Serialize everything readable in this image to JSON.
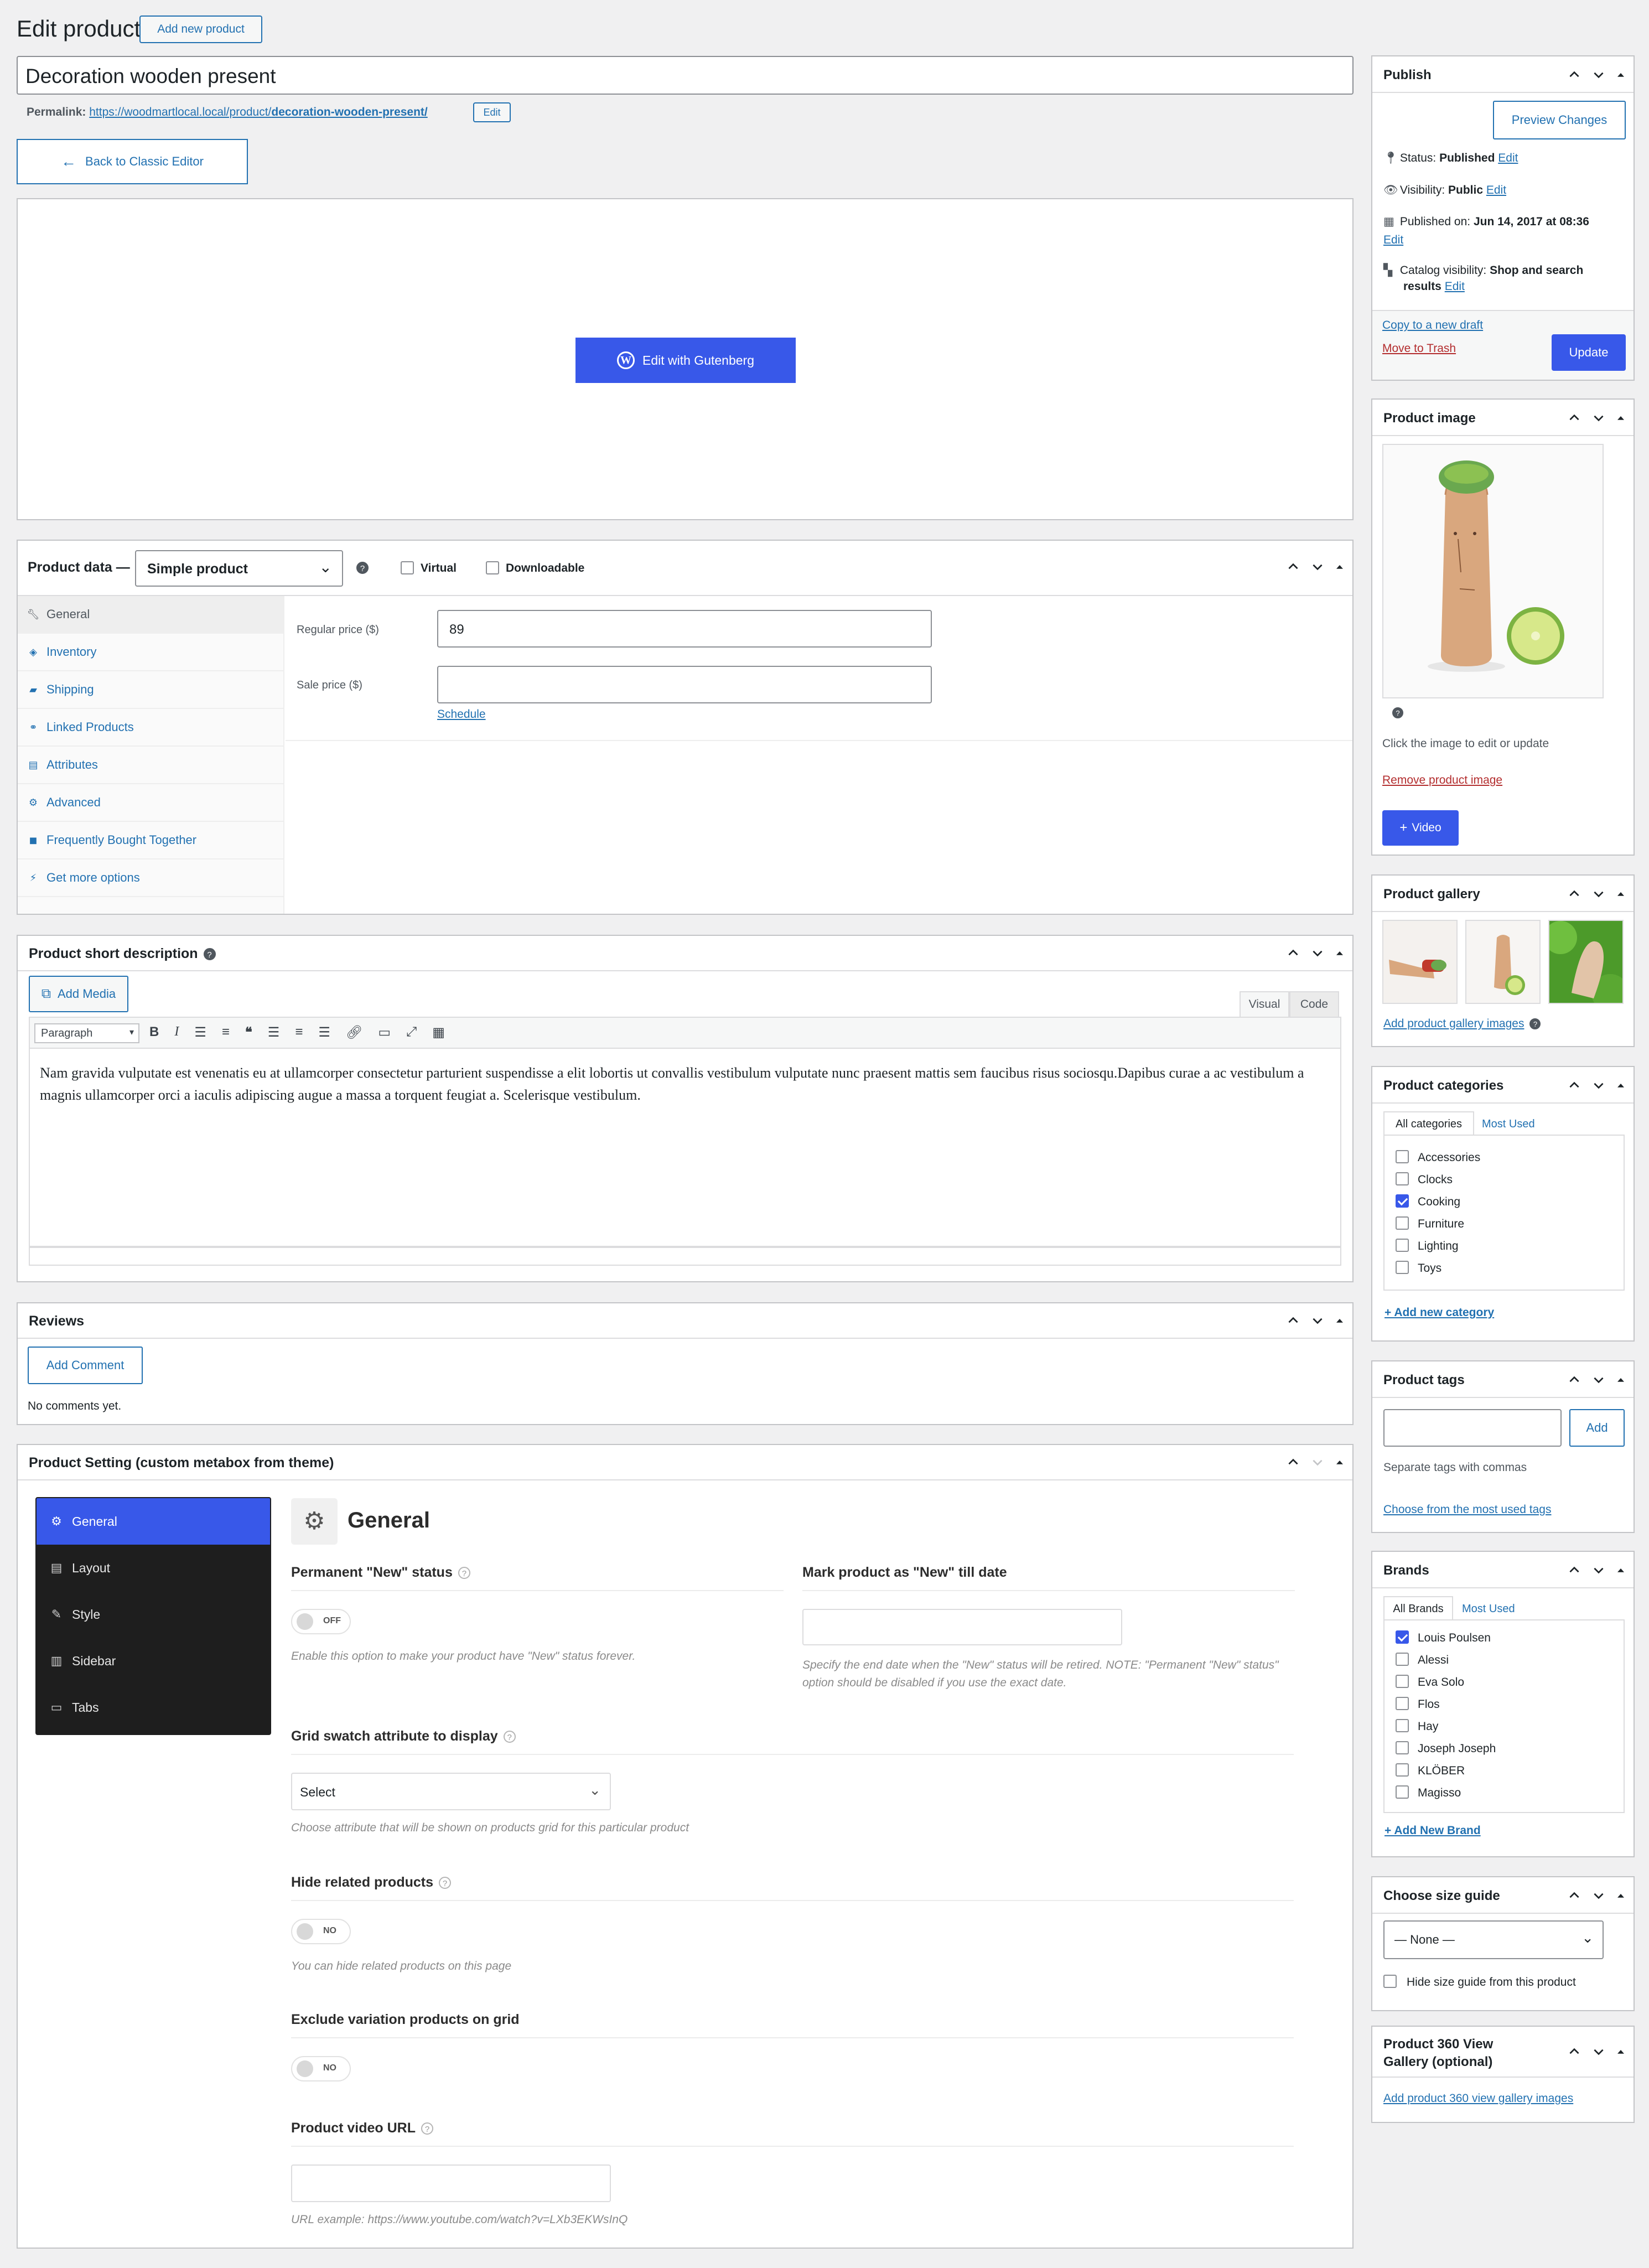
{
  "page": {
    "title": "Edit product",
    "add_new_label": "Add new product",
    "product_title": "Decoration wooden present",
    "permalink_label": "Permalink:",
    "permalink_base": "https://woodmartlocal.local/product/",
    "permalink_slug": "decoration-wooden-present/",
    "permalink_edit": "Edit",
    "back_classic": "Back to Classic Editor",
    "edit_gutenberg": "Edit with Gutenberg"
  },
  "product_data": {
    "title": "Product data —",
    "type": "Simple product",
    "virtual_label": "Virtual",
    "downloadable_label": "Downloadable",
    "tabs": [
      {
        "label": "General",
        "icon": "wrench-icon"
      },
      {
        "label": "Inventory",
        "icon": "tag-icon"
      },
      {
        "label": "Shipping",
        "icon": "truck-icon"
      },
      {
        "label": "Linked Products",
        "icon": "link-icon"
      },
      {
        "label": "Attributes",
        "icon": "table-icon"
      },
      {
        "label": "Advanced",
        "icon": "gear-icon"
      },
      {
        "label": "Frequently Bought Together",
        "icon": "bag-icon"
      },
      {
        "label": "Get more options",
        "icon": "plugin-icon"
      }
    ],
    "regular_price_label": "Regular price ($)",
    "regular_price": "89",
    "sale_price_label": "Sale price ($)",
    "sale_price": "",
    "schedule": "Schedule"
  },
  "short_desc": {
    "title": "Product short description",
    "add_media": "Add Media",
    "tab_visual": "Visual",
    "tab_code": "Code",
    "format": "Paragraph",
    "content": "Nam gravida vulputate est venenatis eu at ullamcorper consectetur parturient suspendisse a elit lobortis ut convallis vestibulum vulputate nunc praesent mattis sem faucibus risus sociosqu.Dapibus curae a ac vestibulum a magnis ullamcorper orci a iaculis adipiscing augue a massa a torquent feugiat a. Scelerisque vestibulum."
  },
  "reviews": {
    "title": "Reviews",
    "add_comment": "Add Comment",
    "empty": "No comments yet."
  },
  "product_setting": {
    "title": "Product Setting (custom metabox from theme)",
    "nav": [
      "General",
      "Layout",
      "Style",
      "Sidebar",
      "Tabs"
    ],
    "section_title": "General",
    "new_status_label": "Permanent \"New\" status",
    "new_status_toggle": "OFF",
    "new_status_desc": "Enable this option to make your product have \"New\" status forever.",
    "new_till_label": "Mark product as \"New\" till date",
    "new_till_value": "",
    "new_till_desc": "Specify the end date when the \"New\" status will be retired. NOTE: \"Permanent \"New\" status\" option should be disabled if you use the exact date.",
    "swatch_label": "Grid swatch attribute to display",
    "swatch_value": "Select",
    "swatch_desc": "Choose attribute that will be shown on products grid for this particular product",
    "hide_related_label": "Hide related products",
    "hide_related_toggle": "NO",
    "hide_related_desc": "You can hide related products on this page",
    "exclude_var_label": "Exclude variation products on grid",
    "exclude_var_toggle": "NO",
    "video_label": "Product video URL",
    "video_value": "",
    "video_desc": "URL example: https://www.youtube.com/watch?v=LXb3EKWsInQ"
  },
  "publish": {
    "title": "Publish",
    "preview": "Preview Changes",
    "status_label": "Status:",
    "status_value": "Published",
    "visibility_label": "Visibility:",
    "visibility_value": "Public",
    "published_label": "Published on:",
    "published_value": "Jun 14, 2017 at 08:36",
    "catalog_label": "Catalog visibility:",
    "catalog_value_1": "Shop and search",
    "catalog_value_2": "results",
    "edit": "Edit",
    "copy_draft": "Copy to a new draft",
    "trash": "Move to Trash",
    "update": "Update"
  },
  "product_image": {
    "title": "Product image",
    "hint": "Click the image to edit or update",
    "remove": "Remove product image",
    "video_btn": "Video"
  },
  "gallery": {
    "title": "Product gallery",
    "add": "Add product gallery images"
  },
  "categories": {
    "title": "Product categories",
    "tab_all": "All categories",
    "tab_used": "Most Used",
    "items": [
      {
        "label": "Accessories",
        "checked": false
      },
      {
        "label": "Clocks",
        "checked": false
      },
      {
        "label": "Cooking",
        "checked": true
      },
      {
        "label": "Furniture",
        "checked": false
      },
      {
        "label": "Lighting",
        "checked": false
      },
      {
        "label": "Toys",
        "checked": false
      }
    ],
    "add_new": "+ Add new category"
  },
  "tags": {
    "title": "Product tags",
    "input_value": "",
    "add": "Add",
    "hint": "Separate tags with commas",
    "choose": "Choose from the most used tags"
  },
  "brands": {
    "title": "Brands",
    "tab_all": "All Brands",
    "tab_used": "Most Used",
    "items": [
      {
        "label": "Louis Poulsen",
        "checked": true
      },
      {
        "label": "Alessi",
        "checked": false
      },
      {
        "label": "Eva Solo",
        "checked": false
      },
      {
        "label": "Flos",
        "checked": false
      },
      {
        "label": "Hay",
        "checked": false
      },
      {
        "label": "Joseph Joseph",
        "checked": false
      },
      {
        "label": "KLÖBER",
        "checked": false
      },
      {
        "label": "Magisso",
        "checked": false
      }
    ],
    "add_new": "+ Add New Brand"
  },
  "size_guide": {
    "title": "Choose size guide",
    "value": "— None —",
    "hide_label": "Hide size guide from this product"
  },
  "view360": {
    "title_1": "Product 360 View",
    "title_2": "Gallery (optional)",
    "add": "Add product 360 view gallery images"
  },
  "colors": {
    "accent": "#3858e9",
    "link": "#2271b1",
    "danger": "#b32d2e",
    "dark_nav": "#1e1e1e",
    "background": "#f0f0f1"
  }
}
